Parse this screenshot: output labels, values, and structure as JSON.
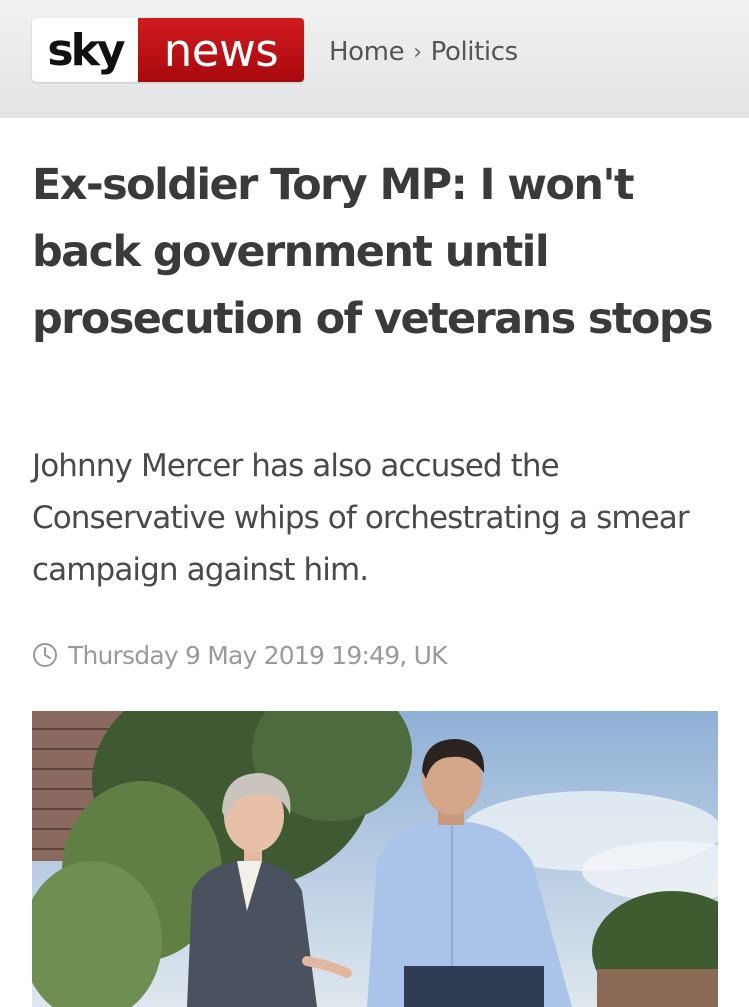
{
  "header": {
    "logo_sky": "sky",
    "logo_news": "news",
    "breadcrumb": {
      "home": "Home",
      "separator": "›",
      "section": "Politics"
    }
  },
  "article": {
    "headline": "Ex-soldier Tory MP: I won't back government until prosecution of veterans stops",
    "standfirst": "Johnny Mercer has also accused the Conservative whips of orchestrating a smear campaign against him.",
    "timestamp": "Thursday 9 May 2019 19:49, UK",
    "timestamp_icon": "clock-icon"
  },
  "colors": {
    "brand_red": "#c4161c",
    "headline_text": "#3a3a3a",
    "meta_text": "#9a9a9a"
  }
}
